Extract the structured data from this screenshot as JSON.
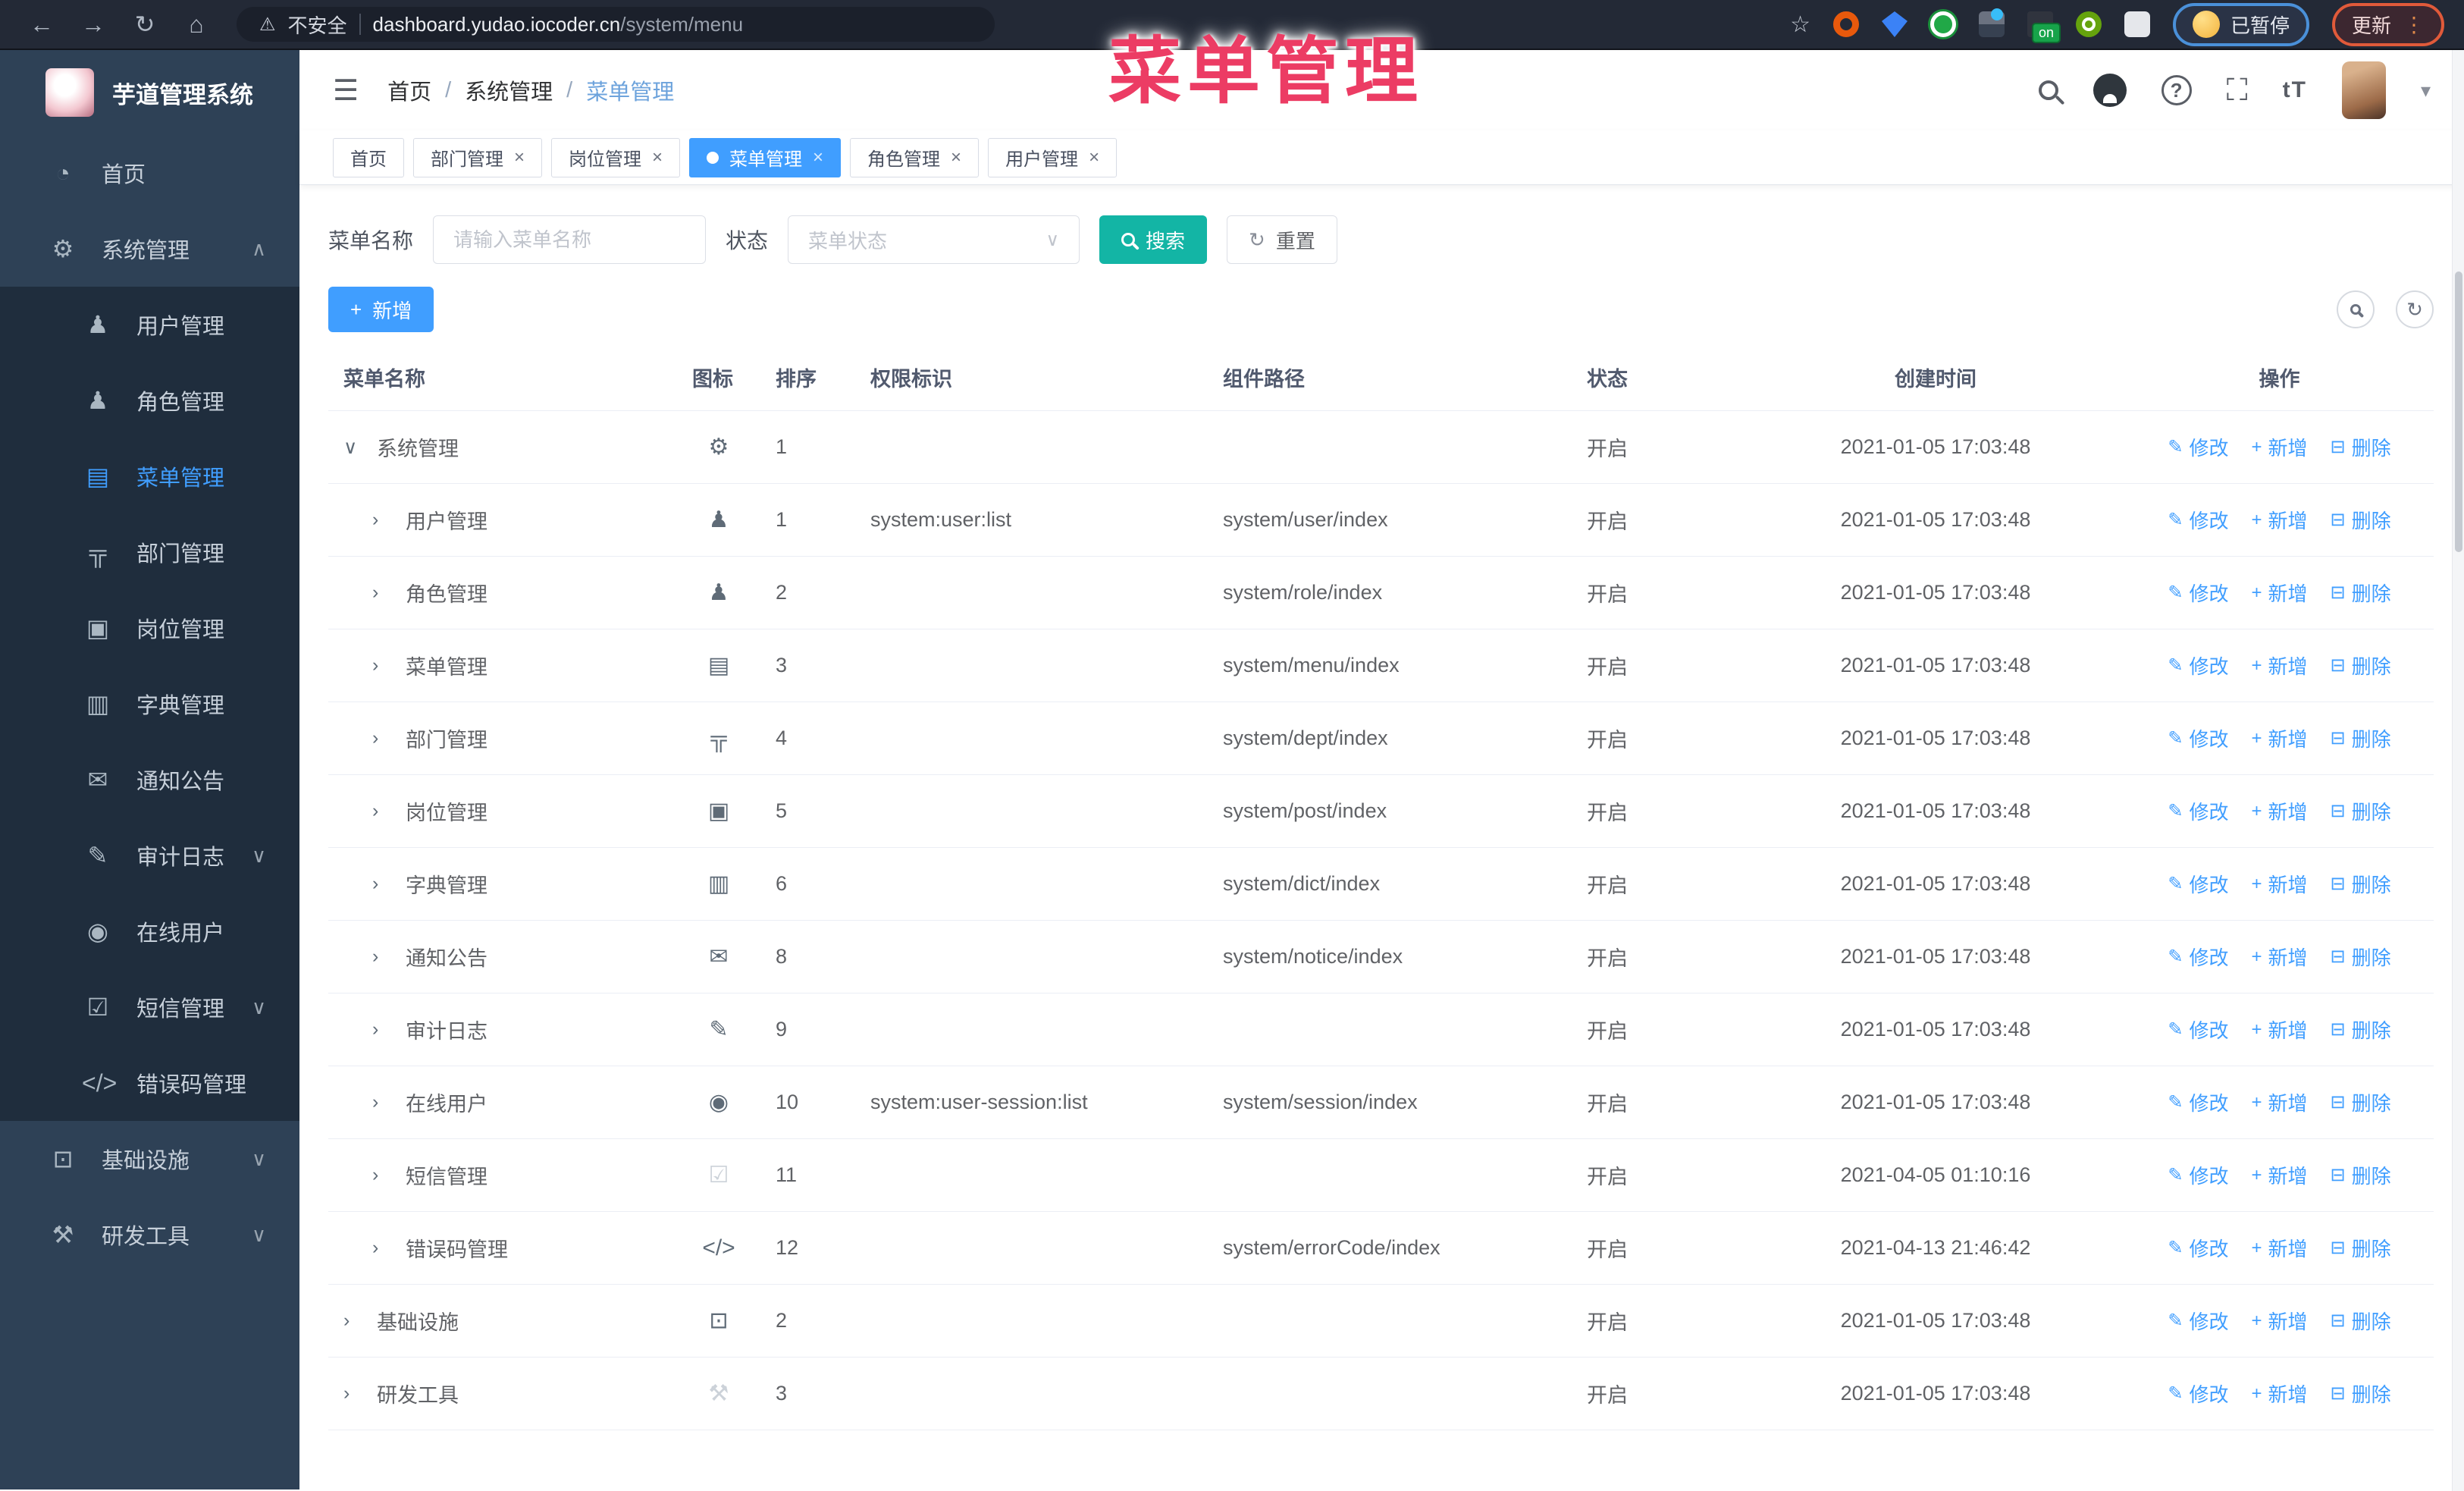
{
  "overlay_title": "菜单管理",
  "chrome": {
    "security_label": "不安全",
    "url_host": "dashboard.yudao.iocoder.cn",
    "url_path": "/system/menu",
    "on_badge": "on",
    "paused_label": "已暂停",
    "update_label": "更新"
  },
  "sidebar": {
    "logo_title": "芋道管理系统",
    "items": [
      {
        "label": "首页",
        "icon": "dashboard-icon",
        "level": 1
      },
      {
        "label": "系统管理",
        "icon": "gear-icon",
        "level": 1,
        "caret": "up"
      },
      {
        "label": "用户管理",
        "icon": "user-icon",
        "level": 2
      },
      {
        "label": "角色管理",
        "icon": "users-icon",
        "level": 2
      },
      {
        "label": "菜单管理",
        "icon": "menu-icon",
        "level": 2,
        "active": true
      },
      {
        "label": "部门管理",
        "icon": "tree-icon",
        "level": 2
      },
      {
        "label": "岗位管理",
        "icon": "badge-icon",
        "level": 2
      },
      {
        "label": "字典管理",
        "icon": "dict-icon",
        "level": 2
      },
      {
        "label": "通知公告",
        "icon": "message-icon",
        "level": 2
      },
      {
        "label": "审计日志",
        "icon": "edit-icon",
        "level": 2,
        "caret": "down"
      },
      {
        "label": "在线用户",
        "icon": "online-icon",
        "level": 2
      },
      {
        "label": "短信管理",
        "icon": "shield-icon",
        "level": 2,
        "caret": "down"
      },
      {
        "label": "错误码管理",
        "icon": "code-icon",
        "level": 2
      },
      {
        "label": "基础设施",
        "icon": "monitor-icon",
        "level": 1,
        "caret": "down"
      },
      {
        "label": "研发工具",
        "icon": "toolbox-icon",
        "level": 1,
        "caret": "down"
      }
    ]
  },
  "header": {
    "breadcrumb": {
      "home": "首页",
      "parent": "系统管理",
      "current": "菜单管理",
      "separator": "/"
    }
  },
  "tabs": [
    {
      "label": "首页"
    },
    {
      "label": "部门管理",
      "closable": true
    },
    {
      "label": "岗位管理",
      "closable": true
    },
    {
      "label": "菜单管理",
      "closable": true,
      "active": true
    },
    {
      "label": "角色管理",
      "closable": true
    },
    {
      "label": "用户管理",
      "closable": true
    }
  ],
  "filters": {
    "name_label": "菜单名称",
    "name_placeholder": "请输入菜单名称",
    "status_label": "状态",
    "status_placeholder": "菜单状态",
    "search_label": "搜索",
    "reset_label": "重置"
  },
  "toolbar": {
    "add_label": "新增"
  },
  "table": {
    "columns": [
      "菜单名称",
      "图标",
      "排序",
      "权限标识",
      "组件路径",
      "状态",
      "创建时间",
      "操作"
    ],
    "action_labels": {
      "edit": "修改",
      "add": "新增",
      "del": "删除"
    },
    "rows": [
      {
        "name": "系统管理",
        "level": 0,
        "caret": "down",
        "icon": "gear-icon",
        "sort": "1",
        "perm": "",
        "path": "",
        "status": "开启",
        "time": "2021-01-05 17:03:48"
      },
      {
        "name": "用户管理",
        "level": 1,
        "caret": "right",
        "icon": "user-icon",
        "sort": "1",
        "perm": "system:user:list",
        "path": "system/user/index",
        "status": "开启",
        "time": "2021-01-05 17:03:48"
      },
      {
        "name": "角色管理",
        "level": 1,
        "caret": "right",
        "icon": "users-icon",
        "sort": "2",
        "perm": "",
        "path": "system/role/index",
        "status": "开启",
        "time": "2021-01-05 17:03:48"
      },
      {
        "name": "菜单管理",
        "level": 1,
        "caret": "right",
        "icon": "menu-icon",
        "sort": "3",
        "perm": "",
        "path": "system/menu/index",
        "status": "开启",
        "time": "2021-01-05 17:03:48"
      },
      {
        "name": "部门管理",
        "level": 1,
        "caret": "right",
        "icon": "tree-icon",
        "sort": "4",
        "perm": "",
        "path": "system/dept/index",
        "status": "开启",
        "time": "2021-01-05 17:03:48"
      },
      {
        "name": "岗位管理",
        "level": 1,
        "caret": "right",
        "icon": "badge-icon",
        "sort": "5",
        "perm": "",
        "path": "system/post/index",
        "status": "开启",
        "time": "2021-01-05 17:03:48"
      },
      {
        "name": "字典管理",
        "level": 1,
        "caret": "right",
        "icon": "dict-icon",
        "sort": "6",
        "perm": "",
        "path": "system/dict/index",
        "status": "开启",
        "time": "2021-01-05 17:03:48"
      },
      {
        "name": "通知公告",
        "level": 1,
        "caret": "right",
        "icon": "message-icon",
        "sort": "8",
        "perm": "",
        "path": "system/notice/index",
        "status": "开启",
        "time": "2021-01-05 17:03:48"
      },
      {
        "name": "审计日志",
        "level": 1,
        "caret": "right",
        "icon": "edit-icon",
        "sort": "9",
        "perm": "",
        "path": "",
        "status": "开启",
        "time": "2021-01-05 17:03:48"
      },
      {
        "name": "在线用户",
        "level": 1,
        "caret": "right",
        "icon": "online-icon",
        "sort": "10",
        "perm": "system:user-session:list",
        "path": "system/session/index",
        "status": "开启",
        "time": "2021-01-05 17:03:48"
      },
      {
        "name": "短信管理",
        "level": 1,
        "caret": "right",
        "icon": "shield-icon",
        "sort": "11",
        "perm": "",
        "path": "",
        "status": "开启",
        "time": "2021-04-05 01:10:16",
        "light": true
      },
      {
        "name": "错误码管理",
        "level": 1,
        "caret": "right",
        "icon": "code-icon",
        "sort": "12",
        "perm": "",
        "path": "system/errorCode/index",
        "status": "开启",
        "time": "2021-04-13 21:46:42"
      },
      {
        "name": "基础设施",
        "level": 0,
        "caret": "right",
        "icon": "monitor-icon",
        "sort": "2",
        "perm": "",
        "path": "",
        "status": "开启",
        "time": "2021-01-05 17:03:48"
      },
      {
        "name": "研发工具",
        "level": 0,
        "caret": "right",
        "icon": "toolbox-icon",
        "sort": "3",
        "perm": "",
        "path": "",
        "status": "开启",
        "time": "2021-01-05 17:03:48",
        "light": true
      }
    ]
  },
  "icon_glyphs": {
    "arrow-left-icon": "←",
    "arrow-right-icon": "→",
    "reload-icon": "↻",
    "home-icon": "⌂",
    "warning-icon": "⚠",
    "star-icon": "☆",
    "kebab-icon": "⋮",
    "close-icon": "×",
    "caret-up": "∧",
    "caret-down": "∨",
    "caret-right": "›",
    "dropdown-caret": "▾",
    "dashboard-icon": "◔",
    "gear-icon": "⚙",
    "user-icon": "♟",
    "users-icon": "♟",
    "menu-icon": "▤",
    "tree-icon": "╦",
    "badge-icon": "▣",
    "dict-icon": "▥",
    "message-icon": "✉",
    "edit-icon": "✎",
    "online-icon": "◉",
    "shield-icon": "☑",
    "code-icon": "</>",
    "monitor-icon": "⊡",
    "toolbox-icon": "⚒",
    "plus-icon": "+",
    "delete-icon": "⊟",
    "refresh-icon": "↻",
    "question-icon": "?",
    "fullscreen-icon": "⛶",
    "font-size-icon": "tT",
    "hamburger-icon": "☰"
  },
  "colors": {
    "accent": "#409eff",
    "search_teal": "#13b5a5",
    "sidebar_bg": "#2e4156",
    "submenu_bg": "#1f2d3d",
    "annotation_pink": "#ec3c64",
    "link_blue": "#409eff"
  }
}
